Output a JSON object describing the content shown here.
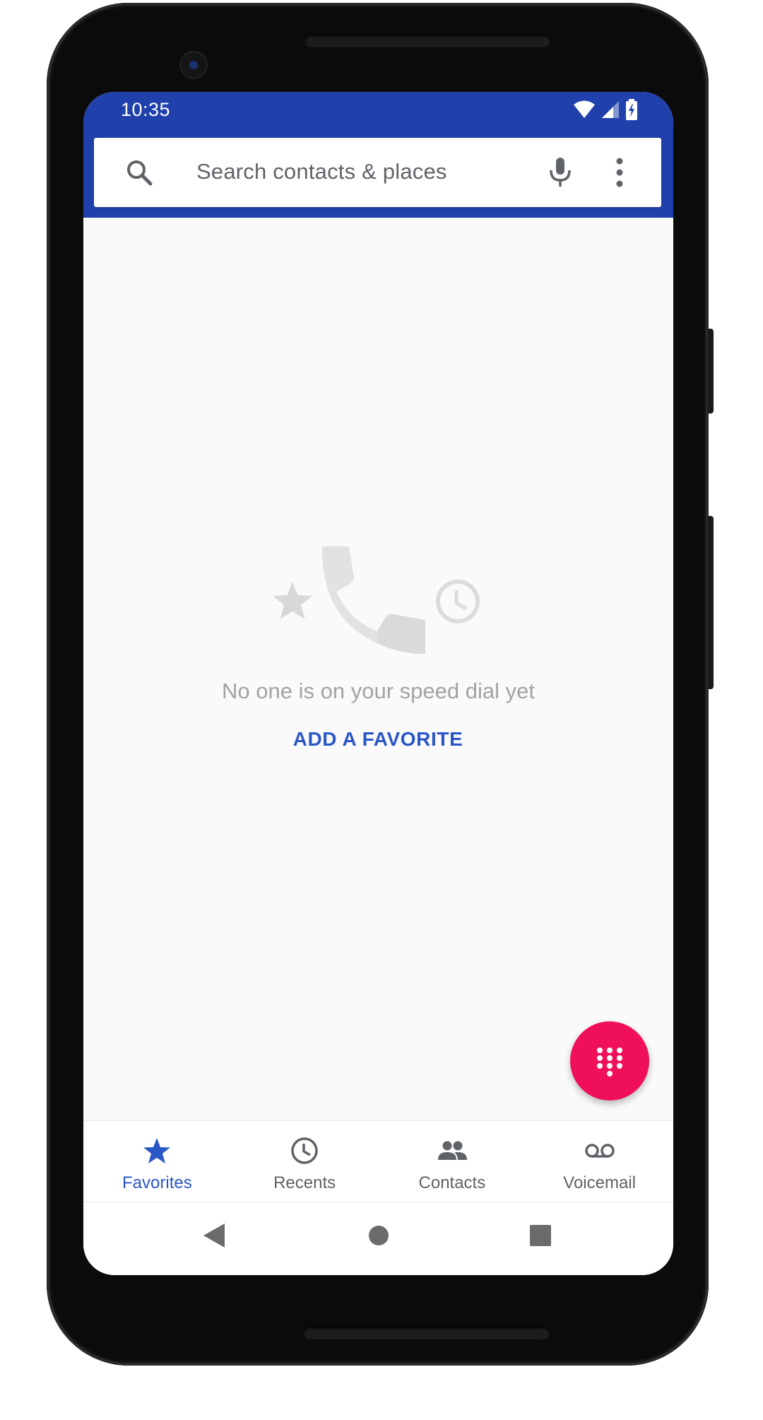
{
  "status_bar": {
    "time": "10:35",
    "icons": [
      "wifi-icon",
      "signal-icon",
      "battery-charging-icon"
    ]
  },
  "search": {
    "placeholder": "Search contacts & places",
    "icons": [
      "search-icon",
      "mic-icon",
      "more-vert-icon"
    ]
  },
  "empty_state": {
    "illustration_icons": [
      "star-icon",
      "phone-icon",
      "clock-icon"
    ],
    "message": "No one is on your speed dial yet",
    "action_label": "ADD A FAVORITE"
  },
  "fab": {
    "icon": "dialpad-icon"
  },
  "bottom_nav": {
    "tabs": [
      {
        "label": "Favorites",
        "icon": "star-icon",
        "active": true
      },
      {
        "label": "Recents",
        "icon": "clock-icon",
        "active": false
      },
      {
        "label": "Contacts",
        "icon": "people-icon",
        "active": false
      },
      {
        "label": "Voicemail",
        "icon": "voicemail-icon",
        "active": false
      }
    ]
  },
  "system_nav": {
    "buttons": [
      "back-icon",
      "home-icon",
      "overview-icon"
    ]
  },
  "colors": {
    "header": "#2041ac",
    "accent": "#2a56c6",
    "fab": "#f0105a",
    "background": "#fafafa",
    "muted_text": "#a3a3a3"
  }
}
